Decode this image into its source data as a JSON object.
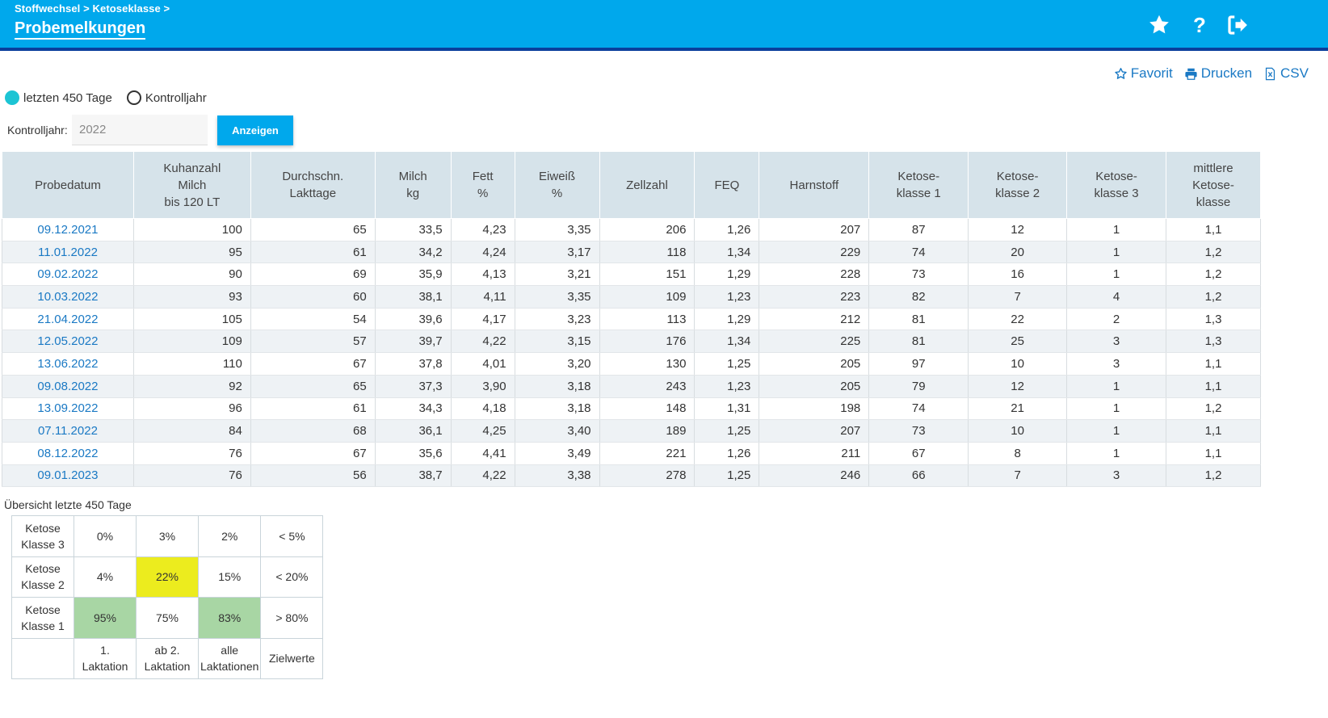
{
  "header": {
    "breadcrumb": "Stoffwechsel > Ketoseklasse >",
    "title": "Probemelkungen",
    "icons": [
      "star-icon",
      "help-icon",
      "logout-icon"
    ],
    "help_glyph": "?"
  },
  "actions": {
    "favorit": "Favorit",
    "drucken": "Drucken",
    "csv": "CSV"
  },
  "filter": {
    "option_days": "letzten 450 Tage",
    "option_year": "Kontrolljahr",
    "selected": "letzten 450 Tage",
    "year_label": "Kontrolljahr:",
    "year_value": "2022",
    "show_button": "Anzeigen"
  },
  "table": {
    "headers": [
      [
        "Probedatum"
      ],
      [
        "Kuhanzahl",
        "Milch",
        "bis 120 LT"
      ],
      [
        "Durchschn.",
        "Lakttage"
      ],
      [
        "Milch",
        "kg"
      ],
      [
        "Fett",
        "%"
      ],
      [
        "Eiweiß",
        "%"
      ],
      [
        "Zellzahl"
      ],
      [
        "FEQ"
      ],
      [
        "Harnstoff"
      ],
      [
        "Ketose-",
        "klasse 1"
      ],
      [
        "Ketose-",
        "klasse 2"
      ],
      [
        "Ketose-",
        "klasse 3"
      ],
      [
        "mittlere",
        "Ketose-",
        "klasse"
      ]
    ],
    "rows": [
      [
        "09.12.2021",
        "100",
        "65",
        "33,5",
        "4,23",
        "3,35",
        "206",
        "1,26",
        "207",
        "87",
        "12",
        "1",
        "1,1"
      ],
      [
        "11.01.2022",
        "95",
        "61",
        "34,2",
        "4,24",
        "3,17",
        "118",
        "1,34",
        "229",
        "74",
        "20",
        "1",
        "1,2"
      ],
      [
        "09.02.2022",
        "90",
        "69",
        "35,9",
        "4,13",
        "3,21",
        "151",
        "1,29",
        "228",
        "73",
        "16",
        "1",
        "1,2"
      ],
      [
        "10.03.2022",
        "93",
        "60",
        "38,1",
        "4,11",
        "3,35",
        "109",
        "1,23",
        "223",
        "82",
        "7",
        "4",
        "1,2"
      ],
      [
        "21.04.2022",
        "105",
        "54",
        "39,6",
        "4,17",
        "3,23",
        "113",
        "1,29",
        "212",
        "81",
        "22",
        "2",
        "1,3"
      ],
      [
        "12.05.2022",
        "109",
        "57",
        "39,7",
        "4,22",
        "3,15",
        "176",
        "1,34",
        "225",
        "81",
        "25",
        "3",
        "1,3"
      ],
      [
        "13.06.2022",
        "110",
        "67",
        "37,8",
        "4,01",
        "3,20",
        "130",
        "1,25",
        "205",
        "97",
        "10",
        "3",
        "1,1"
      ],
      [
        "09.08.2022",
        "92",
        "65",
        "37,3",
        "3,90",
        "3,18",
        "243",
        "1,23",
        "205",
        "79",
        "12",
        "1",
        "1,1"
      ],
      [
        "13.09.2022",
        "96",
        "61",
        "34,3",
        "4,18",
        "3,18",
        "148",
        "1,31",
        "198",
        "74",
        "21",
        "1",
        "1,2"
      ],
      [
        "07.11.2022",
        "84",
        "68",
        "36,1",
        "4,25",
        "3,40",
        "189",
        "1,25",
        "207",
        "73",
        "10",
        "1",
        "1,1"
      ],
      [
        "08.12.2022",
        "76",
        "67",
        "35,6",
        "4,41",
        "3,49",
        "221",
        "1,26",
        "211",
        "67",
        "8",
        "1",
        "1,1"
      ],
      [
        "09.01.2023",
        "76",
        "56",
        "38,7",
        "4,22",
        "3,38",
        "278",
        "1,25",
        "246",
        "66",
        "7",
        "3",
        "1,2"
      ]
    ]
  },
  "overview": {
    "title": "Übersicht letzte 450 Tage",
    "rows": [
      {
        "label": [
          "Ketose",
          "Klasse 3"
        ],
        "cells": [
          "0%",
          "3%",
          "2%",
          "< 5%"
        ],
        "highlight": [
          "",
          "",
          "",
          ""
        ]
      },
      {
        "label": [
          "Ketose",
          "Klasse 2"
        ],
        "cells": [
          "4%",
          "22%",
          "15%",
          "< 20%"
        ],
        "highlight": [
          "",
          "yellow",
          "",
          ""
        ]
      },
      {
        "label": [
          "Ketose",
          "Klasse 1"
        ],
        "cells": [
          "95%",
          "75%",
          "83%",
          "> 80%"
        ],
        "highlight": [
          "green",
          "",
          "green",
          ""
        ]
      }
    ],
    "footer": [
      [
        "1. Laktation"
      ],
      [
        "ab 2.",
        "Laktation"
      ],
      [
        "alle",
        "Laktationen"
      ],
      [
        "Zielwerte"
      ]
    ],
    "colors": {
      "yellow": "#ecec1e",
      "green": "#a8d6a4"
    }
  },
  "colors": {
    "header_bg": "#00a8ec",
    "accent_line": "#0a3f9c",
    "link": "#1a79c4",
    "table_header": "#d6e3ea"
  }
}
